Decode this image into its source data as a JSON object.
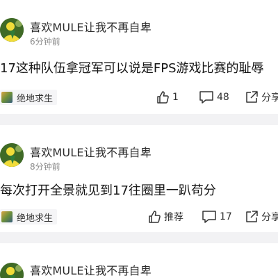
{
  "posts": [
    {
      "author": "喜欢MULE让我不再自卑",
      "time": "6分钟前",
      "content": "17这种队伍拿冠军可以说是FPS游戏比赛的耻辱",
      "tag": "绝地求生",
      "like_label": "1",
      "comment_count": "48",
      "share_label": "分享"
    },
    {
      "author": "喜欢MULE让我不再自卑",
      "time": "8分钟前",
      "content": "每次打开全景就见到17往圈里一趴苟分",
      "tag": "绝地求生",
      "like_label": "推荐",
      "comment_count": "17",
      "share_label": "分享"
    },
    {
      "author": "喜欢MULE让我不再自卑"
    }
  ]
}
